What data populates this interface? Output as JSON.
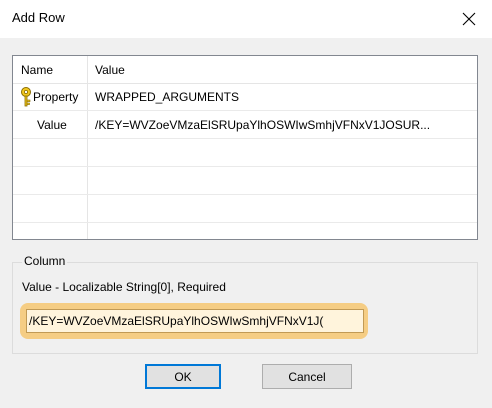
{
  "dialog": {
    "title": "Add Row",
    "close_icon": "close-icon"
  },
  "grid": {
    "headers": {
      "name": "Name",
      "value": "Value"
    },
    "rows": [
      {
        "name": "Property",
        "value": "WRAPPED_ARGUMENTS",
        "icon": "key-icon"
      },
      {
        "name": "Value",
        "value": "/KEY=WVZoeVMzaElSRUpaYlhOSWIwSmhjVFNxV1JOSUR..."
      }
    ]
  },
  "column": {
    "group_title": "Column",
    "description": "Value - Localizable String[0], Required",
    "input_value": "/KEY=WVZoeVMzaElSRUpaYlhOSWIwSmhjVFNxV1J("
  },
  "buttons": {
    "ok": "OK",
    "cancel": "Cancel"
  },
  "colors": {
    "highlight": "#f5cd84",
    "focus_border": "#0078d7"
  }
}
